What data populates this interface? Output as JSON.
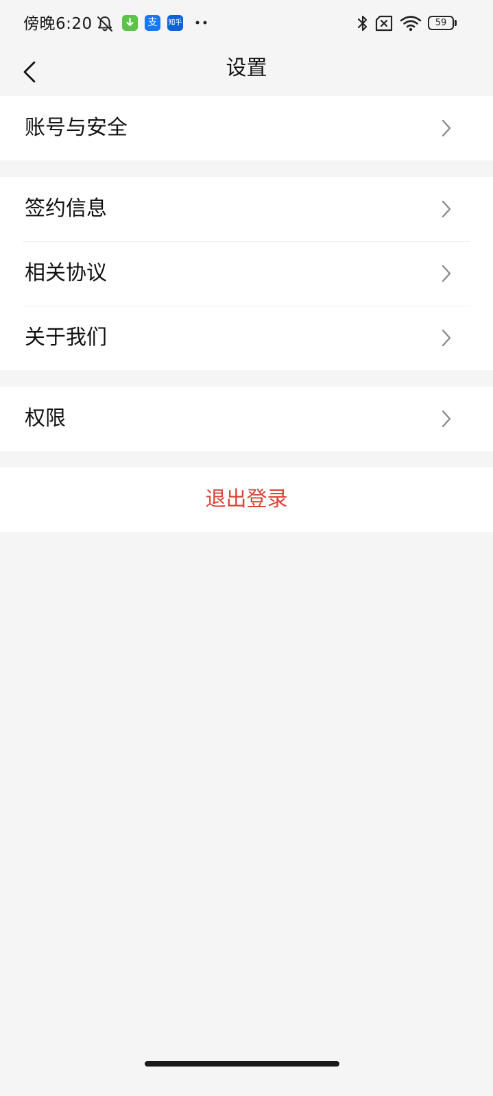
{
  "status_bar": {
    "time": "傍晚6:20",
    "notification_icons": [
      "mute-icon",
      "download-app-icon",
      "alipay-app-icon",
      "zhihu-app-icon",
      "more-dots-icon"
    ],
    "apps": {
      "alipay_glyph": "支",
      "zhihu_glyph": "知乎"
    },
    "system_icons": [
      "bluetooth-icon",
      "no-sim-icon",
      "wifi-icon",
      "battery-icon"
    ],
    "battery_level": "59",
    "colors": {
      "download_app": "#5cc24a",
      "alipay_app": "#1677ff",
      "zhihu_app": "#0a63d6"
    }
  },
  "header": {
    "title": "设置",
    "back_icon": "chevron-left-icon"
  },
  "groups": [
    {
      "items": [
        {
          "label": "账号与安全"
        }
      ]
    },
    {
      "items": [
        {
          "label": "签约信息"
        },
        {
          "label": "相关协议"
        },
        {
          "label": "关于我们"
        }
      ]
    },
    {
      "items": [
        {
          "label": "权限"
        }
      ]
    }
  ],
  "logout": {
    "label": "退出登录",
    "color": "#d9443a"
  }
}
